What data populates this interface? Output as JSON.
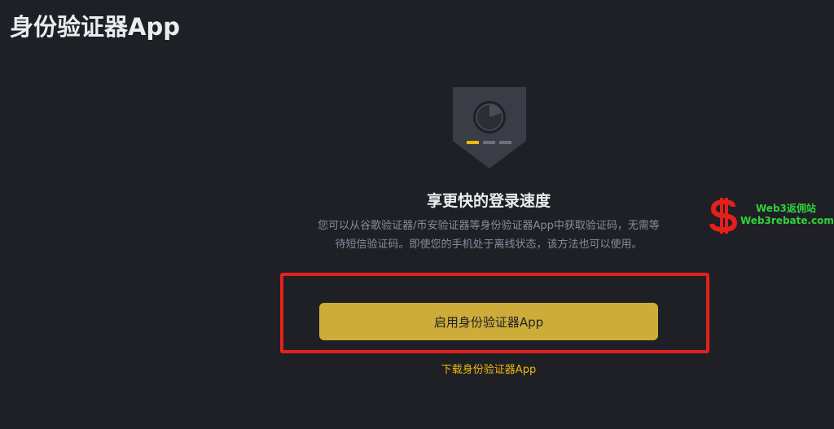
{
  "header": {
    "title": "身份验证器App"
  },
  "illustration": {
    "icon": "shield-authenticator-icon",
    "step_indicator": {
      "active_step": 1,
      "total_steps": 3
    }
  },
  "feature": {
    "title": "享更快的登录速度",
    "description": "您可以从谷歌验证器/币安验证器等身份验证器App中获取验证码，无需等待短信验证码。即使您的手机处于离线状态，该方法也可以使用。"
  },
  "actions": {
    "enable_label": "启用身份验证器App",
    "download_label": "下载身份验证器App"
  },
  "watermark": {
    "line1": "Web3返佣站",
    "line2": "Web3rebate.com"
  },
  "colors": {
    "background": "#1f2026",
    "accent": "#cdac39",
    "link": "#f0b90b",
    "highlight": "#e3201b",
    "muted_text": "#848e9c",
    "watermark": "#2fd23a"
  }
}
